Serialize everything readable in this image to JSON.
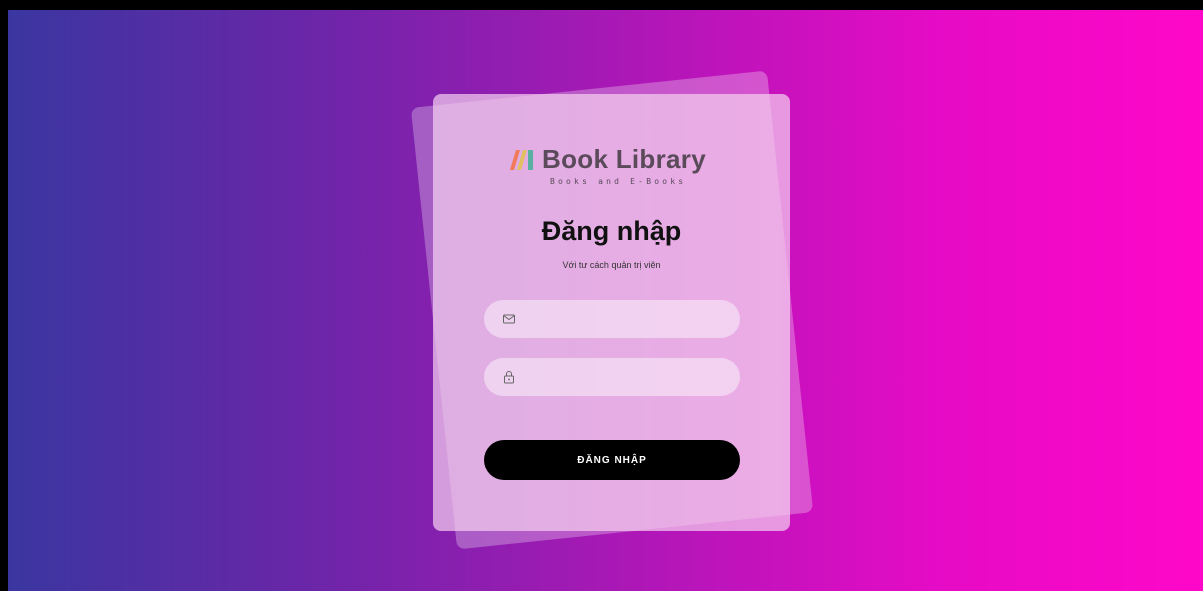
{
  "colors": {
    "gradient_start": "#3a36a0",
    "gradient_end": "#ff07c8",
    "button_bg": "#000000"
  },
  "logo": {
    "title": "Book Library",
    "subtitle": "Books and E-Books",
    "mark_icon": "book-spines-icon"
  },
  "login": {
    "title": "Đăng nhập",
    "subtitle": "Với tư cách quản trị viên",
    "email_field": {
      "icon": "mail-icon",
      "placeholder": "",
      "value": ""
    },
    "password_field": {
      "icon": "lock-icon",
      "placeholder": "",
      "value": ""
    },
    "submit_label": "ĐĂNG NHẬP"
  }
}
